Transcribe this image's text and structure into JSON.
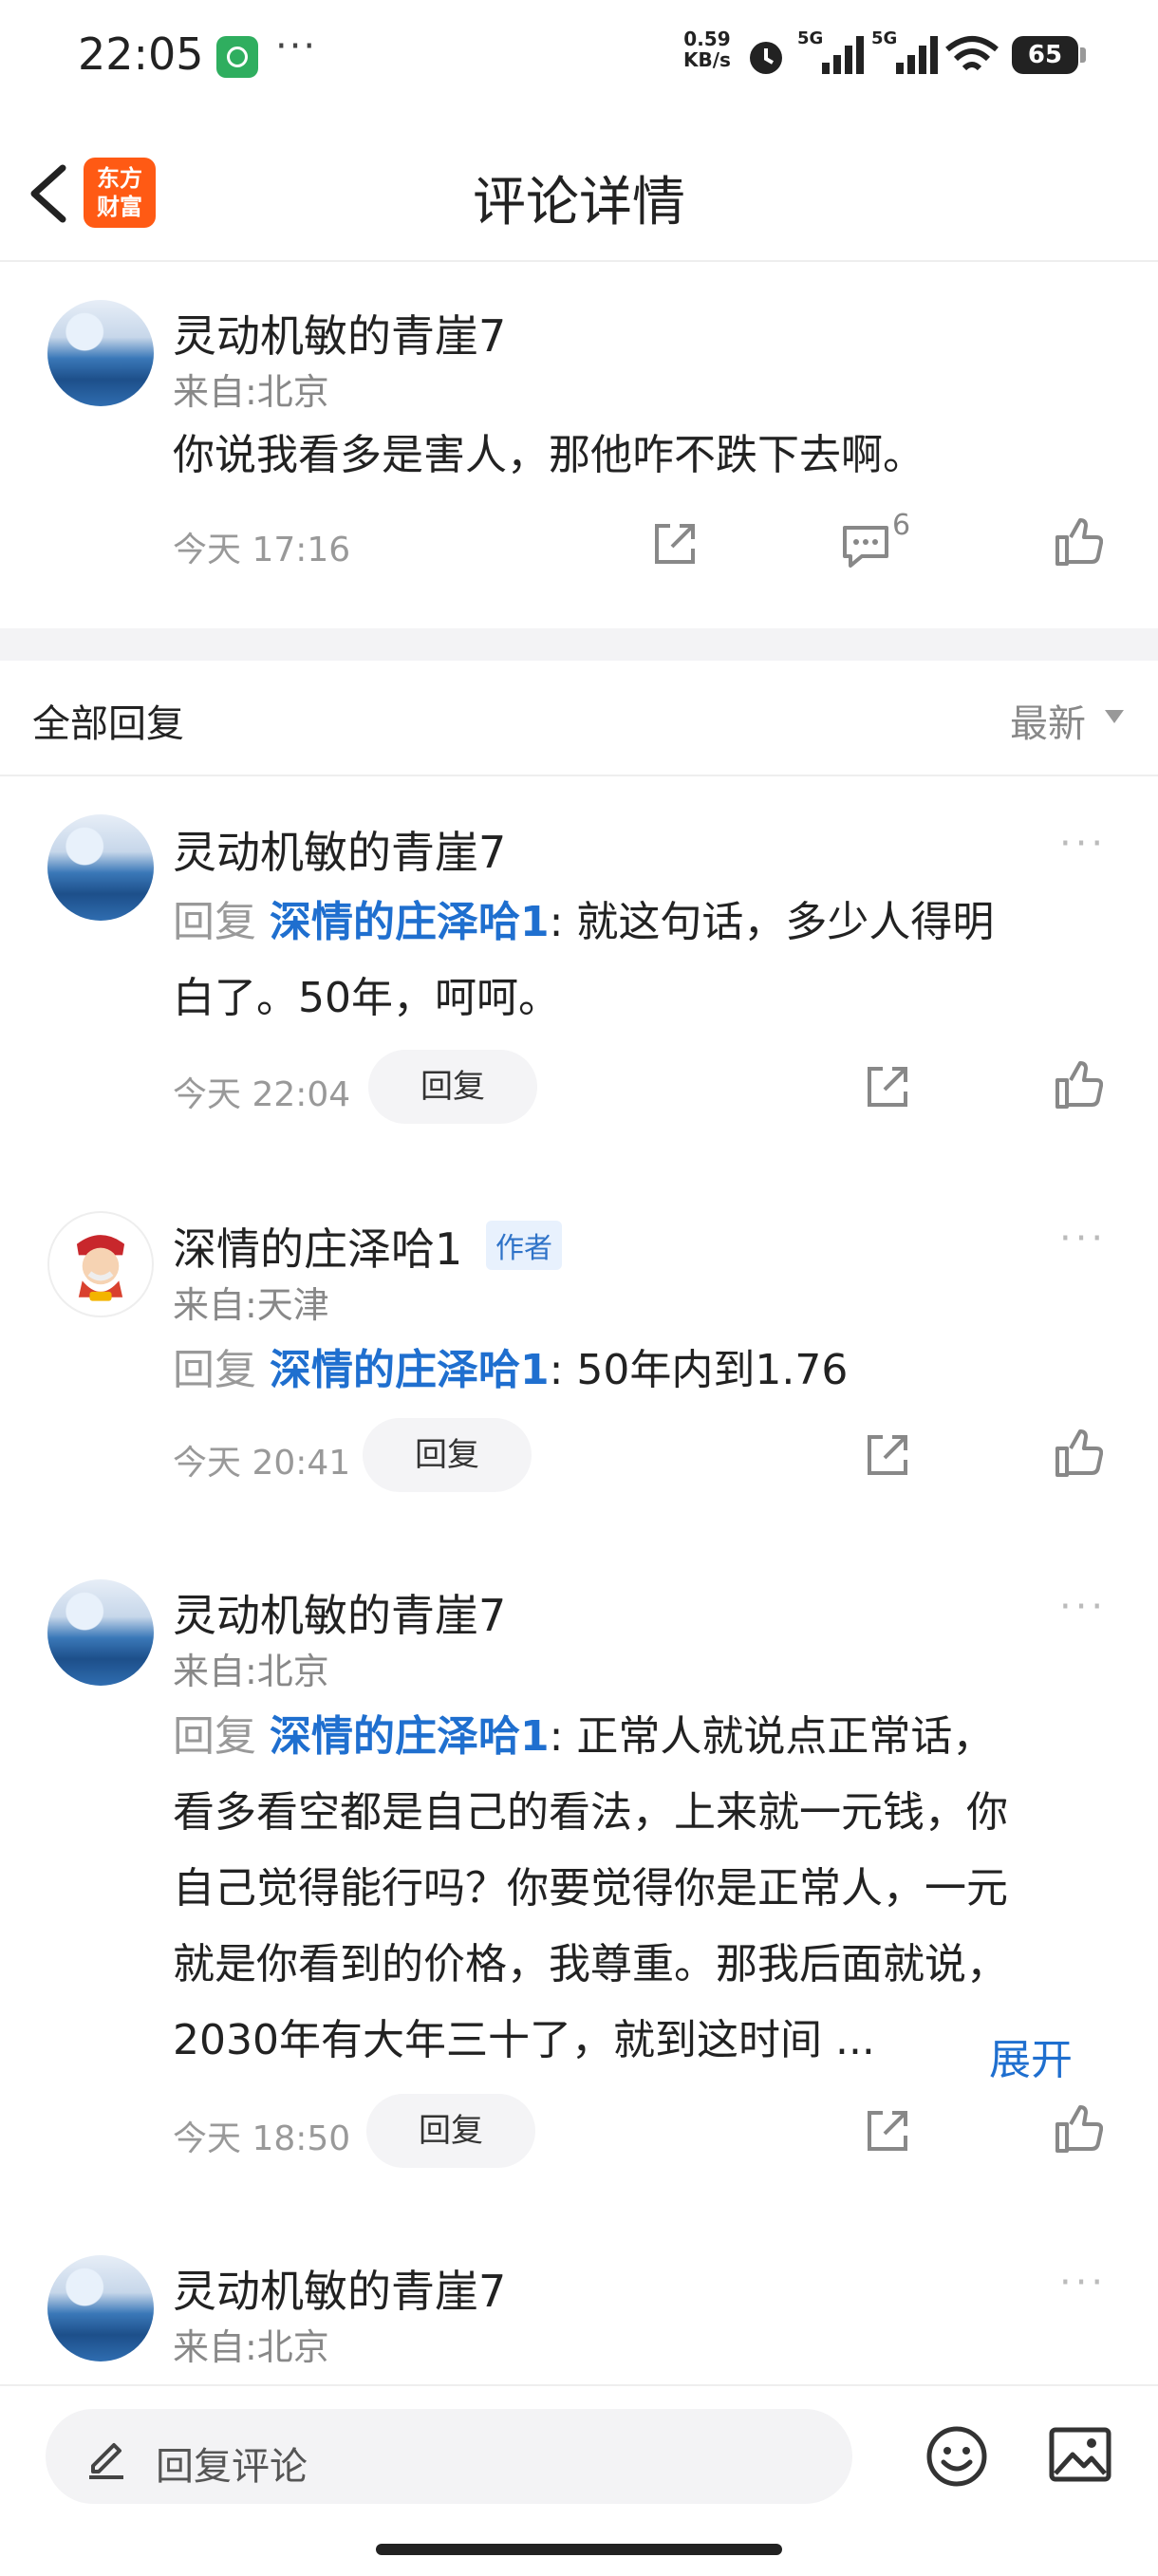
{
  "status_bar": {
    "time": "22:05",
    "more_dots": "···",
    "net_speed_value": "0.59",
    "net_speed_unit": "KB/s",
    "battery": "65"
  },
  "header": {
    "title": "评论详情",
    "logo_line1": "东方",
    "logo_line2": "财富"
  },
  "main_comment": {
    "author": "灵动机敏的青崖7",
    "location": "来自:北京",
    "text": "你说我看多是害人，那他咋不跌下去啊。",
    "time": "今天 17:16",
    "comment_count": "6"
  },
  "replies_section": {
    "title": "全部回复",
    "sort": "最新"
  },
  "replies": [
    {
      "author": "灵动机敏的青崖7",
      "reply_prefix": "回复",
      "mention": "深情的庄泽哈1",
      "line1": ": 就这句话，多少人得明",
      "line2": "白了。50年，呵呵。",
      "time": "今天 22:04",
      "reply_button": "回复"
    },
    {
      "author": "深情的庄泽哈1",
      "author_badge": "作者",
      "location": "来自:天津",
      "reply_prefix": "回复",
      "mention": "深情的庄泽哈1",
      "line1": ": 50年内到1.76",
      "time": "今天 20:41",
      "reply_button": "回复"
    },
    {
      "author": "灵动机敏的青崖7",
      "location": "来自:北京",
      "reply_prefix": "回复",
      "mention": "深情的庄泽哈1",
      "line1": ": 正常人就说点正常话，",
      "line2": "看多看空都是自己的看法，上来就一元钱，你",
      "line3": "自己觉得能行吗？你要觉得你是正常人，一元",
      "line4": "就是你看到的价格，我尊重。那我后面就说，",
      "line5": "2030年有大年三十了，就到这时间 ...",
      "expand": "展开",
      "time": "今天 18:50",
      "reply_button": "回复"
    },
    {
      "author": "灵动机敏的青崖7",
      "location": "来自:北京"
    }
  ],
  "bottom_bar": {
    "input_placeholder": "回复评论"
  }
}
